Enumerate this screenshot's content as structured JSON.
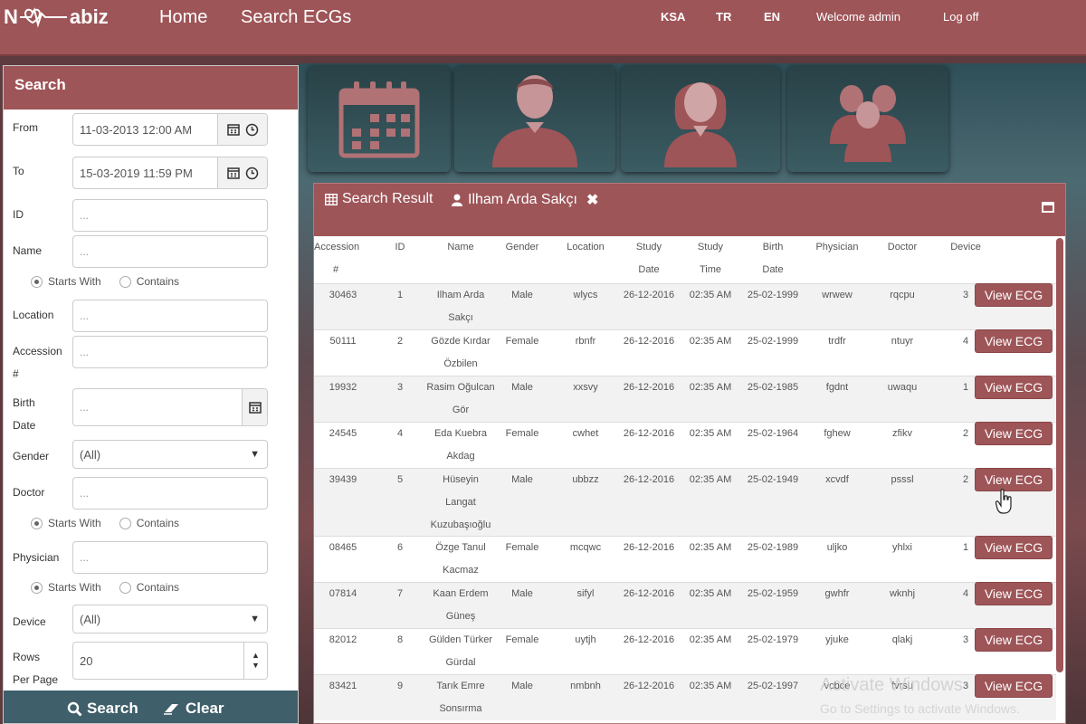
{
  "nav": {
    "logo_left": "N",
    "logo_right": "abiz",
    "home": "Home",
    "search_ecgs": "Search ECGs",
    "lang_ksa": "KSA",
    "lang_tr": "TR",
    "lang_en": "EN",
    "welcome": "Welcome admin",
    "logoff": "Log off"
  },
  "sidebar": {
    "title": "Search",
    "from_label": "From",
    "from_value": "11-03-2013 12:00 AM",
    "to_label": "To",
    "to_value": "15-03-2019 11:59 PM",
    "id_label": "ID",
    "placeholder": "...",
    "name_label": "Name",
    "starts_with": "Starts With",
    "contains": "Contains",
    "location_label": "Location",
    "accession_label_1": "Accession",
    "accession_label_2": "#",
    "birth_label_1": "Birth",
    "birth_label_2": "Date",
    "gender_label": "Gender",
    "gender_value": "(All)",
    "doctor_label": "Doctor",
    "physician_label": "Physician",
    "device_label": "Device",
    "device_value": "(All)",
    "rows_label_1": "Rows",
    "rows_label_2": "Per Page",
    "rows_value": "20",
    "search_btn": "Search",
    "clear_btn": "Clear"
  },
  "panel": {
    "title": "Search Result",
    "patient": "Ilham Arda Sakçı"
  },
  "table": {
    "headers": {
      "accession_1": "Accession",
      "accession_2": "#",
      "id": "ID",
      "name": "Name",
      "gender": "Gender",
      "location": "Location",
      "study_date_1": "Study",
      "study_date_2": "Date",
      "study_time_1": "Study",
      "study_time_2": "Time",
      "birth_1": "Birth",
      "birth_2": "Date",
      "physician": "Physician",
      "doctor": "Doctor",
      "device": "Device"
    },
    "view_label": "View ECG",
    "rows": [
      {
        "acc": "30463",
        "id": "1",
        "name1": "Ilham Arda",
        "name2": "Sakçı",
        "name3": "",
        "gender": "Male",
        "loc": "wlycs",
        "sdate": "26-12-2016",
        "stime": "02:35 AM",
        "bdate": "25-02-1999",
        "phys": "wrwew",
        "doc": "rqcpu",
        "dev": "3"
      },
      {
        "acc": "50111",
        "id": "2",
        "name1": "Gözde Kırdar",
        "name2": "Özbilen",
        "name3": "",
        "gender": "Female",
        "loc": "rbnfr",
        "sdate": "26-12-2016",
        "stime": "02:35 AM",
        "bdate": "25-02-1999",
        "phys": "trdfr",
        "doc": "ntuyr",
        "dev": "4"
      },
      {
        "acc": "19932",
        "id": "3",
        "name1": "Rasim Oğulcan",
        "name2": "Gör",
        "name3": "",
        "gender": "Male",
        "loc": "xxsvy",
        "sdate": "26-12-2016",
        "stime": "02:35 AM",
        "bdate": "25-02-1985",
        "phys": "fgdnt",
        "doc": "uwaqu",
        "dev": "1"
      },
      {
        "acc": "24545",
        "id": "4",
        "name1": "Eda Kuebra",
        "name2": "Akdag",
        "name3": "",
        "gender": "Female",
        "loc": "cwhet",
        "sdate": "26-12-2016",
        "stime": "02:35 AM",
        "bdate": "25-02-1964",
        "phys": "fghew",
        "doc": "zfikv",
        "dev": "2"
      },
      {
        "acc": "39439",
        "id": "5",
        "name1": "Hüseyin",
        "name2": "Langat",
        "name3": "Kuzubaşıoğlu",
        "gender": "Male",
        "loc": "ubbzz",
        "sdate": "26-12-2016",
        "stime": "02:35 AM",
        "bdate": "25-02-1949",
        "phys": "xcvdf",
        "doc": "psssl",
        "dev": "2"
      },
      {
        "acc": "08465",
        "id": "6",
        "name1": "Özge Tanul",
        "name2": "Kacmaz",
        "name3": "",
        "gender": "Female",
        "loc": "mcqwc",
        "sdate": "26-12-2016",
        "stime": "02:35 AM",
        "bdate": "25-02-1989",
        "phys": "uljko",
        "doc": "yhlxi",
        "dev": "1"
      },
      {
        "acc": "07814",
        "id": "7",
        "name1": "Kaan Erdem",
        "name2": "Güneş",
        "name3": "",
        "gender": "Male",
        "loc": "sifyl",
        "sdate": "26-12-2016",
        "stime": "02:35 AM",
        "bdate": "25-02-1959",
        "phys": "gwhfr",
        "doc": "wknhj",
        "dev": "4"
      },
      {
        "acc": "82012",
        "id": "8",
        "name1": "Gülden Türker",
        "name2": "Gürdal",
        "name3": "",
        "gender": "Female",
        "loc": "uytjh",
        "sdate": "26-12-2016",
        "stime": "02:35 AM",
        "bdate": "25-02-1979",
        "phys": "yjuke",
        "doc": "qlakj",
        "dev": "3"
      },
      {
        "acc": "83421",
        "id": "9",
        "name1": "Tarık Emre",
        "name2": "Sonsırma",
        "name3": "",
        "gender": "Male",
        "loc": "nmbnh",
        "sdate": "26-12-2016",
        "stime": "02:35 AM",
        "bdate": "25-02-1997",
        "phys": "vcbce",
        "doc": "fvrsu",
        "dev": "3"
      }
    ]
  },
  "watermark": {
    "line1": "Activate Windows",
    "line2": "Go to Settings to activate Windows."
  }
}
